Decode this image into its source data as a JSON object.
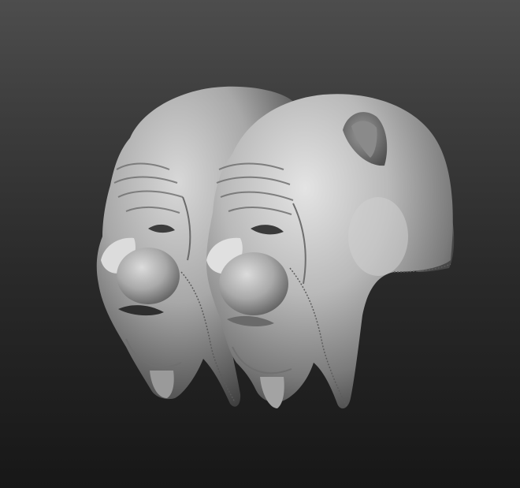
{
  "viewport": {
    "background_top": "#4d4d4d",
    "background_bottom": "#171717"
  },
  "model": {
    "material_color": "#bdbdbd",
    "shadow_color": "#5a5a5a",
    "instances": [
      {
        "kind": "sculpted-clown-head-mask",
        "position": "back-left"
      },
      {
        "kind": "sculpted-clown-head-mask",
        "position": "front-right"
      }
    ]
  }
}
